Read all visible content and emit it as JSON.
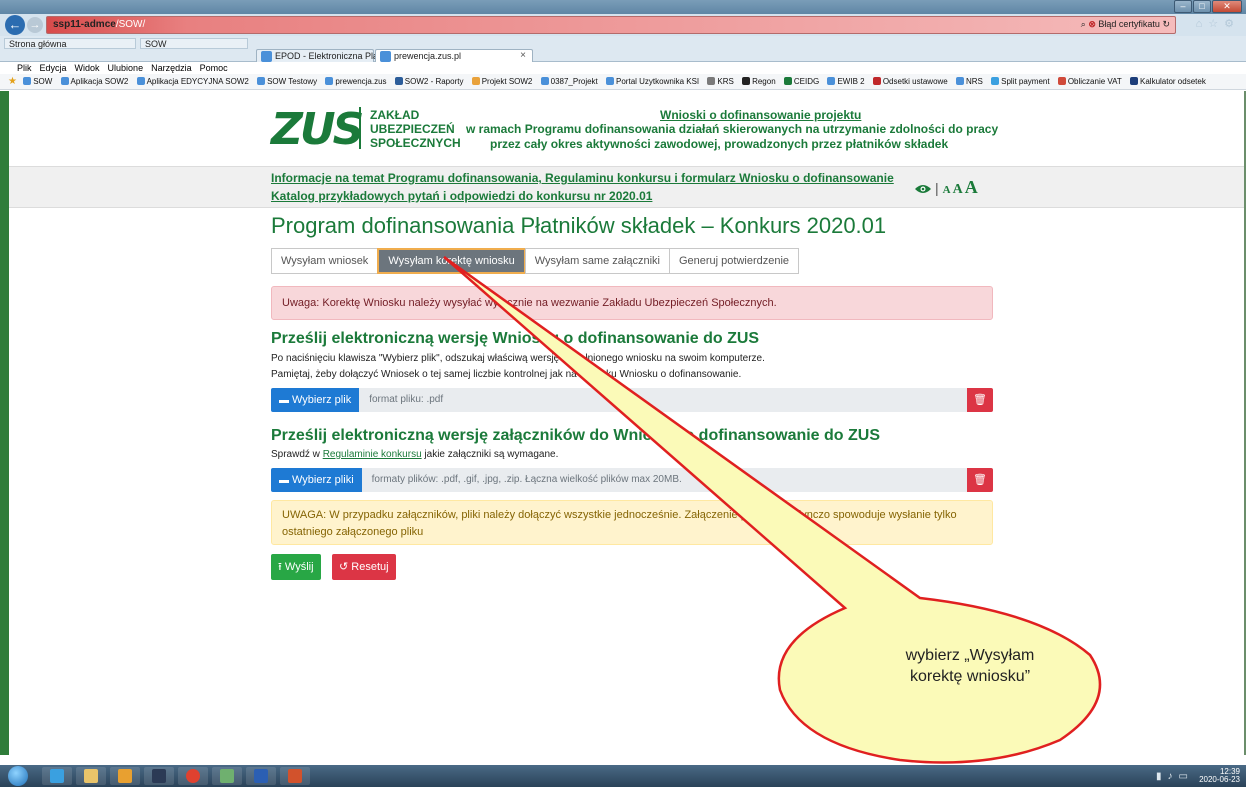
{
  "browser": {
    "url_host": "ssp11-admce",
    "url_path": "/SOW/",
    "cert_error": "Błąd certyfikatu",
    "favorites": [
      {
        "label": "Strona główna"
      },
      {
        "label": "SOW"
      }
    ],
    "tabs": [
      {
        "label": "EPOD - Elektroniczna Platform...",
        "active": false
      },
      {
        "label": "prewencja.zus.pl",
        "active": true
      }
    ],
    "menu": [
      "Plik",
      "Edycja",
      "Widok",
      "Ulubione",
      "Narzędzia",
      "Pomoc"
    ],
    "bookmarks": [
      "SOW",
      "Aplikacja SOW2",
      "Aplikacja EDYCYJNA SOW2",
      "SOW Testowy",
      "prewencja.zus",
      "SOW2 - Raporty",
      "Projekt SOW2",
      "0387_Projekt",
      "Portal Uzytkownika KSI",
      "KRS",
      "Regon",
      "CEIDG",
      "EWIB 2",
      "Odsetki ustawowe",
      "NRS",
      "Split payment",
      "Obliczanie VAT",
      "Kalkulator odsetek"
    ]
  },
  "header": {
    "logo_text": "ZUS",
    "org_line1": "ZAKŁAD",
    "org_line2": "UBEZPIECZEŃ",
    "org_line3": "SPOŁECZNYCH",
    "title_link": "Wnioski o dofinansowanie projektu",
    "subtitle1": "w ramach Programu dofinansowania działań skierowanych na utrzymanie zdolności do pracy",
    "subtitle2": "przez cały okres aktywności zawodowej, prowadzonych przez płatników składek"
  },
  "infobar": {
    "link1": "Informacje na temat Programu dofinansowania, Regulaminu konkursu i formularz Wniosku o dofinansowanie",
    "link2": "Katalog przykładowych pytań i odpowiedzi do konkursu nr 2020.01",
    "a11y_sep": "|",
    "font_small": "A",
    "font_mid": "A",
    "font_big": "A"
  },
  "main": {
    "title": "Program dofinansowania Płatników składek – Konkurs 2020.01",
    "tabs": [
      {
        "label": "Wysyłam wniosek",
        "active": false
      },
      {
        "label": "Wysyłam korektę wniosku",
        "active": true
      },
      {
        "label": "Wysyłam same załączniki",
        "active": false
      },
      {
        "label": "Generuj potwierdzenie",
        "active": false
      }
    ],
    "alert_danger": "Uwaga: Korektę Wniosku należy wysyłać wyłącznie na wezwanie Zakładu Ubezpieczeń Społecznych.",
    "section1": {
      "title": "Prześlij elektroniczną wersję Wniosku o dofinansowanie do ZUS",
      "text1": "Po naciśnięciu klawisza \"Wybierz plik\", odszukaj właściwą wersję wypełnionego wniosku na swoim komputerze.",
      "text2": "Pamiętaj, żeby dołączyć Wniosek o tej samej liczbie kontrolnej jak na wydruku Wniosku o dofinansowanie.",
      "button": "Wybierz plik",
      "placeholder": "format pliku: .pdf"
    },
    "section2": {
      "title": "Prześlij elektroniczną wersję załączników do Wniosku o dofinansowanie do ZUS",
      "text_prefix": "Sprawdź w",
      "text_link": "Regulaminie konkursu",
      "text_suffix": "jakie załączniki są wymagane.",
      "button": "Wybierz pliki",
      "placeholder": "formaty plików: .pdf, .gif, .jpg, .zip. Łączna wielkość plików max 20MB."
    },
    "alert_warning": "UWAGA: W przypadku załączników, pliki należy dołączyć wszystkie jednocześnie. Załączenie plików pojedynczo spowoduje wysłanie tylko ostatniego załączonego pliku",
    "send_button": "Wyślij",
    "reset_button": "Resetuj"
  },
  "callout": {
    "line1": "wybierz „Wysyłam",
    "line2": "korektę wniosku”"
  },
  "taskbar": {
    "time": "12:39",
    "date": "2020-06-23"
  }
}
